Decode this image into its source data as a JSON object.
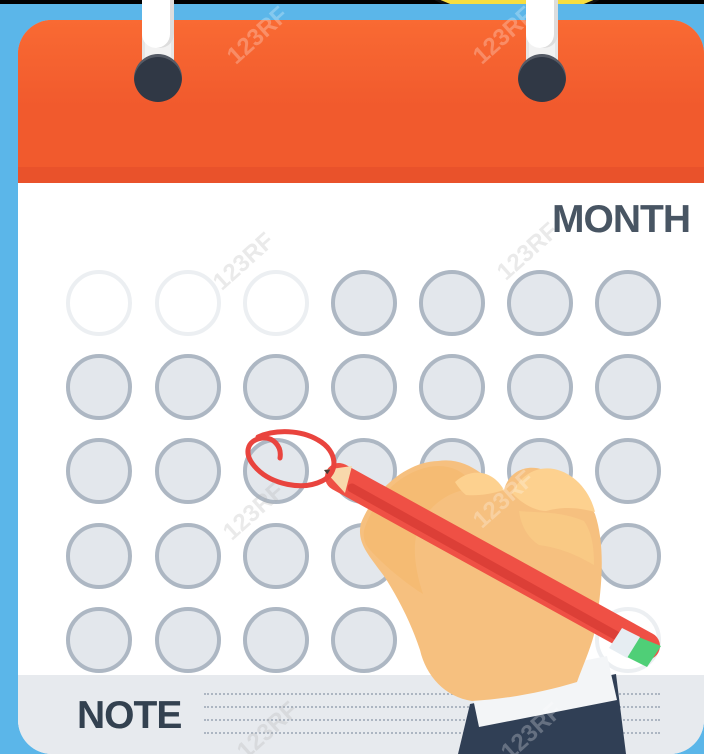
{
  "calendar": {
    "month_label": "MONTH",
    "note_label": "NOTE",
    "accent_color": "#f15a2d",
    "frame_color": "#5bb6e9",
    "bubble_color": "#f7de3f",
    "marked_color": "#e9443e"
  },
  "icons": {
    "speech_bubble": "speech-bubble-icon",
    "calendar_rings": "ring-binder-icon",
    "hand": "hand-icon",
    "pencil": "pencil-icon",
    "mark": "circle-mark-icon"
  },
  "watermark": {
    "text": "123RF"
  }
}
